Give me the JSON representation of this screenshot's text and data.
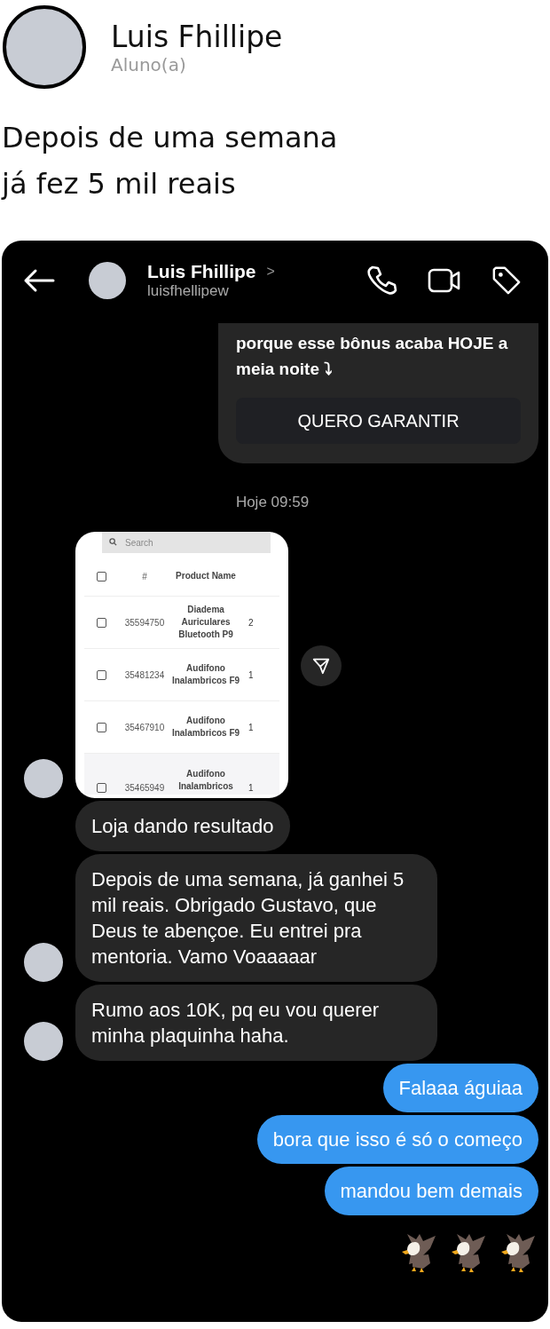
{
  "profile": {
    "name": "Luis Fhillipe",
    "role": "Aluno(a)"
  },
  "caption": [
    "Depois de uma semana",
    "já fez 5 mil reais"
  ],
  "chat": {
    "header": {
      "name": "Luis Fhillipe",
      "chevron": ">",
      "username": "luisfhellipew"
    },
    "messages": [
      {
        "kind": "promo",
        "sent": true,
        "text": "porque esse bônus acaba HOJE a meia noite ⤵",
        "button": "QUERO GARANTIR"
      },
      {
        "kind": "time",
        "text": "Hoje 09:59"
      },
      {
        "kind": "image",
        "sent": false,
        "avatar": true,
        "screenshot": {
          "search_placeholder": "Search",
          "header_checked": false,
          "columns": [
            "#",
            "Product Name"
          ],
          "rows": [
            {
              "checked": false,
              "id": "35594750",
              "name": "Diadema Auriculares Bluetooth P9",
              "column_4": "2"
            },
            {
              "checked": false,
              "id": "35481234",
              "name": "Audifono Inalambricos F9",
              "column_4": "1"
            },
            {
              "checked": false,
              "id": "35467910",
              "name": "Audifono Inalambricos F9",
              "column_4": "1"
            },
            {
              "checked": false,
              "id": "35465949",
              "name": "Audifono Inalambricos",
              "column_4": "1"
            }
          ]
        }
      },
      {
        "kind": "text",
        "sent": false,
        "avatar": false,
        "text": "Loja dando resultado"
      },
      {
        "kind": "text",
        "sent": false,
        "avatar": true,
        "text": "Depois de uma semana, já ganhei 5 mil reais. Obrigado Gustavo, que Deus te abençoe. Eu entrei pra mentoria. Vamo Voaaaaar"
      },
      {
        "kind": "text",
        "sent": false,
        "avatar": true,
        "text": "Rumo aos 10K, pq eu vou querer minha plaquinha haha."
      },
      {
        "kind": "text",
        "sent": true,
        "text": "Falaaa águiaa"
      },
      {
        "kind": "text",
        "sent": true,
        "text": "bora que isso é só o começo"
      },
      {
        "kind": "text",
        "sent": true,
        "text": "mandou bem demais"
      },
      {
        "kind": "reaction",
        "sent": true,
        "emojis": [
          {
            "kind": "eagle"
          },
          {
            "kind": "eagle"
          },
          {
            "kind": "eagle"
          }
        ]
      }
    ]
  }
}
